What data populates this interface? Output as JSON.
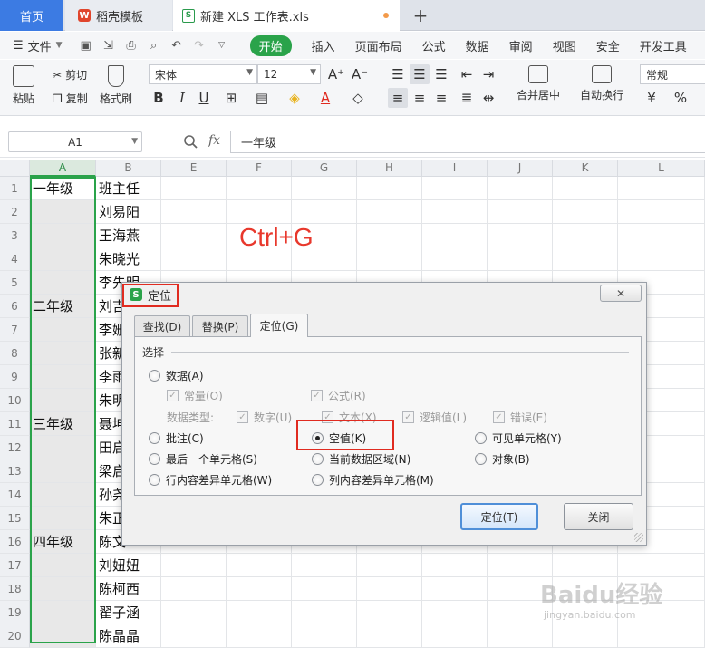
{
  "tabs": {
    "home": "首页",
    "templates": "稻壳模板",
    "file": "新建 XLS 工作表.xls",
    "new_tab": "+"
  },
  "menu": {
    "file": "文件",
    "tabs": [
      "开始",
      "插入",
      "页面布局",
      "公式",
      "数据",
      "审阅",
      "视图",
      "安全",
      "开发工具"
    ]
  },
  "ribbon": {
    "paste": "粘贴",
    "cut": "剪切",
    "copy": "复制",
    "format_painter": "格式刷",
    "font_name": "宋体",
    "font_size": "12",
    "merge_center": "合并居中",
    "wrap_text": "自动换行",
    "number_format": "常规",
    "percent": "%"
  },
  "formula_bar": {
    "name_box": "A1",
    "fx": "fx",
    "content": "一年级"
  },
  "columns": [
    "A",
    "B",
    "E",
    "F",
    "G",
    "H",
    "I",
    "J",
    "K",
    "L"
  ],
  "rows": [
    {
      "num": "1",
      "a": "一年级",
      "b": "班主任"
    },
    {
      "num": "2",
      "a": "",
      "b": "刘易阳"
    },
    {
      "num": "3",
      "a": "",
      "b": "王海燕"
    },
    {
      "num": "4",
      "a": "",
      "b": "朱晓光"
    },
    {
      "num": "5",
      "a": "",
      "b": "李先明"
    },
    {
      "num": "6",
      "a": "二年级",
      "b": "刘吉"
    },
    {
      "num": "7",
      "a": "",
      "b": "李姗"
    },
    {
      "num": "8",
      "a": "",
      "b": "张新"
    },
    {
      "num": "9",
      "a": "",
      "b": "李雨"
    },
    {
      "num": "10",
      "a": "",
      "b": "朱明"
    },
    {
      "num": "11",
      "a": "三年级",
      "b": "聂坤"
    },
    {
      "num": "12",
      "a": "",
      "b": "田启"
    },
    {
      "num": "13",
      "a": "",
      "b": "梁启"
    },
    {
      "num": "14",
      "a": "",
      "b": "孙尧"
    },
    {
      "num": "15",
      "a": "",
      "b": "朱正"
    },
    {
      "num": "16",
      "a": "四年级",
      "b": "陈文"
    },
    {
      "num": "17",
      "a": "",
      "b": "刘妞妞"
    },
    {
      "num": "18",
      "a": "",
      "b": "陈柯西"
    },
    {
      "num": "19",
      "a": "",
      "b": "翟子涵"
    },
    {
      "num": "20",
      "a": "",
      "b": "陈晶晶"
    }
  ],
  "annotation": "Ctrl+G",
  "dialog": {
    "title": "定位",
    "close_x": "✕",
    "tabs": [
      "查找(D)",
      "替换(P)",
      "定位(G)"
    ],
    "group_label": "选择",
    "data_option": "数据(A)",
    "sub_constant": "常量(O)",
    "sub_formula": "公式(R)",
    "data_type_label": "数据类型:",
    "type_number": "数字(U)",
    "type_text": "文本(X)",
    "type_logical": "逻辑值(L)",
    "type_error": "错误(E)",
    "opt_comment": "批注(C)",
    "opt_empty": "空值(K)",
    "opt_visible": "可见单元格(Y)",
    "opt_last_cell": "最后一个单元格(S)",
    "opt_current_region": "当前数据区域(N)",
    "opt_objects": "对象(B)",
    "opt_row_diff": "行内容差异单元格(W)",
    "opt_col_diff": "列内容差异单元格(M)",
    "btn_locate": "定位(T)",
    "btn_close": "关闭"
  },
  "watermark": {
    "main": "Baidu经验",
    "sub": "jingyan.baidu.com"
  }
}
